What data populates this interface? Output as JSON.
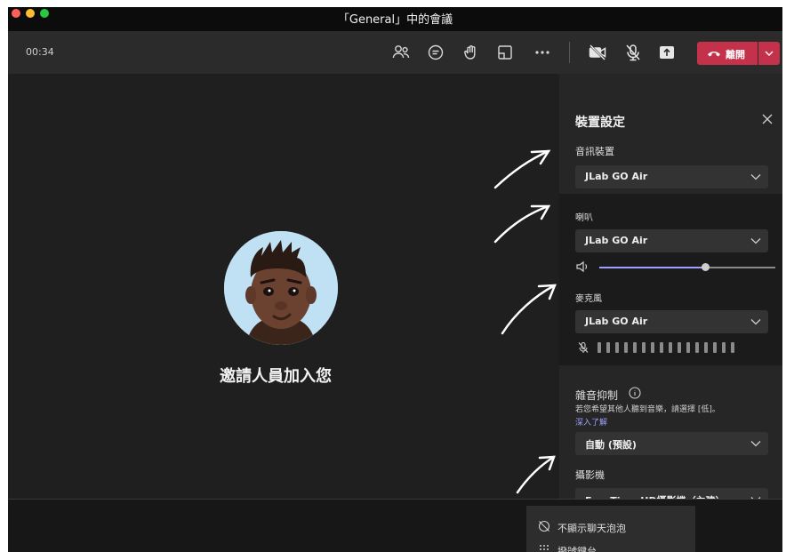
{
  "window": {
    "title": "「General」中的會議"
  },
  "toolbar": {
    "timer": "00:34",
    "icons": [
      "people-icon",
      "chat-icon",
      "raise-hand-icon",
      "share-tray-icon",
      "more-icon",
      "camera-off-icon",
      "mic-off-icon",
      "share-icon"
    ],
    "leave_label": "離開"
  },
  "stage": {
    "invite_text": "邀請人員加入您"
  },
  "settings": {
    "title": "裝置設定",
    "audio_device_label": "音訊裝置",
    "audio_device_value": "JLab GO Air",
    "speaker_label": "喇叭",
    "speaker_value": "JLab GO Air",
    "speaker_volume": 0.6,
    "mic_label": "麥克風",
    "mic_value": "JLab GO Air",
    "noise_label": "雜音抑制",
    "noise_hint": "若您希望其他人聽到音樂，請選擇 [低]。",
    "learn_more": "深入了解",
    "noise_value": "自動 (預設)",
    "camera_label": "攝影機",
    "camera_value": "FaceTime HD攝影機（內建）"
  },
  "popup": {
    "item1": "不顯示聊天泡泡",
    "item2": "撥號鍵台"
  },
  "colors": {
    "leave": "#c4314b",
    "accent": "#9ea2ff",
    "panel": "#262626"
  }
}
